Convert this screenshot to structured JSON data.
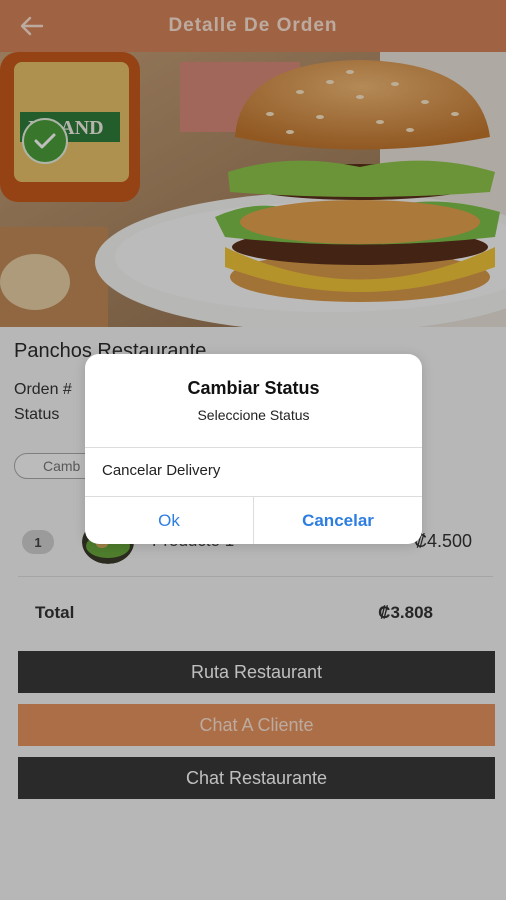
{
  "header": {
    "title": "Detalle De Orden",
    "back_icon": "arrow-left-icon"
  },
  "hero": {
    "badge_icon": "check-icon"
  },
  "order": {
    "restaurant": "Panchos Restaurante",
    "orden_label": "Orden #",
    "status_label": "Status",
    "change_status_button": "Camb"
  },
  "items": [
    {
      "qty": "1",
      "name": "Producto 1",
      "price": "₡4.500"
    }
  ],
  "total": {
    "label": "Total",
    "value": "₡3.808"
  },
  "actions": {
    "route": "Ruta Restaurant",
    "chat_client": "Chat A Cliente",
    "chat_restaurant": "Chat Restaurante"
  },
  "dialog": {
    "title": "Cambiar Status",
    "subtitle": "Seleccione Status",
    "option": "Cancelar Delivery",
    "ok": "Ok",
    "cancel": "Cancelar"
  },
  "colors": {
    "header": "#d4855a",
    "accent_button": "#e6935f",
    "dark_button": "#383838",
    "dialog_link": "#2d7ee0"
  }
}
